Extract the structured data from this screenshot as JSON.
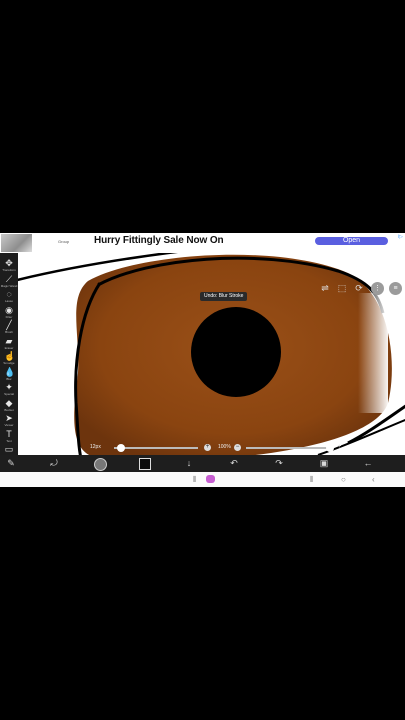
{
  "ad": {
    "small_text": "Group",
    "title": "Hurry Fittingly Sale Now On",
    "button": "Open",
    "corner": "i▷"
  },
  "toolbar": {
    "tools": [
      {
        "name": "transform",
        "label": "Transform",
        "icon": "move-icon",
        "glyph": "✥"
      },
      {
        "name": "magic-wand",
        "label": "Magic Wand",
        "icon": "magic-wand-icon",
        "glyph": "⟋"
      },
      {
        "name": "lasso",
        "label": "Lasso",
        "icon": "lasso-icon",
        "glyph": "◌"
      },
      {
        "name": "filter",
        "label": "Filter",
        "icon": "filter-icon",
        "glyph": "◉"
      },
      {
        "name": "brush",
        "label": "Brush",
        "icon": "brush-icon",
        "glyph": "╱"
      },
      {
        "name": "eraser",
        "label": "Eraser",
        "icon": "eraser-icon",
        "glyph": "▰"
      },
      {
        "name": "smudge",
        "label": "Smudge",
        "icon": "smudge-icon",
        "glyph": "☝"
      },
      {
        "name": "blur",
        "label": "Blur",
        "icon": "blur-icon",
        "glyph": "💧"
      },
      {
        "name": "special",
        "label": "Special",
        "icon": "sparkle-icon",
        "glyph": "✦"
      },
      {
        "name": "bucket",
        "label": "Bucket",
        "icon": "bucket-icon",
        "glyph": "◆"
      },
      {
        "name": "select",
        "label": "Viewer",
        "icon": "cursor-icon",
        "glyph": "➤"
      },
      {
        "name": "text",
        "label": "Text",
        "icon": "text-icon",
        "glyph": "T"
      },
      {
        "name": "frame",
        "label": "Frame",
        "icon": "frame-icon",
        "glyph": "▭"
      },
      {
        "name": "pen",
        "label": "Divider",
        "icon": "pen-icon",
        "glyph": "✎"
      }
    ],
    "active_index": 7
  },
  "canvas": {
    "toast": "Undo: Blur Stroke",
    "iris_color": "#8a4410",
    "pupil_color": "#000000"
  },
  "top_right": {
    "layers_icon": "⇌",
    "select_icon": "⬚",
    "rotate_icon": "⟳",
    "more_icon": "⋮",
    "menu_icon": "≡"
  },
  "sliders": {
    "size_label": "12px",
    "size_percent": 0.08,
    "opacity_label": "100%",
    "opacity_percent": 1.0,
    "minus": "−",
    "plus": "+"
  },
  "bottombar": {
    "items": [
      {
        "name": "modify-icon",
        "glyph": "⤾"
      },
      {
        "name": "brush-preview",
        "glyph": ""
      },
      {
        "name": "color-swatch",
        "glyph": ""
      },
      {
        "name": "save-down-icon",
        "glyph": "↓"
      },
      {
        "name": "undo-icon",
        "glyph": "↶"
      },
      {
        "name": "redo-icon",
        "glyph": "↷"
      },
      {
        "name": "layers-icon",
        "glyph": "▣"
      },
      {
        "name": "back-arrow-icon",
        "glyph": "←"
      }
    ]
  },
  "navbar": {
    "recents": "⦀",
    "home": "",
    "back": "‹",
    "recents2": "⦀",
    "circle": "○"
  }
}
